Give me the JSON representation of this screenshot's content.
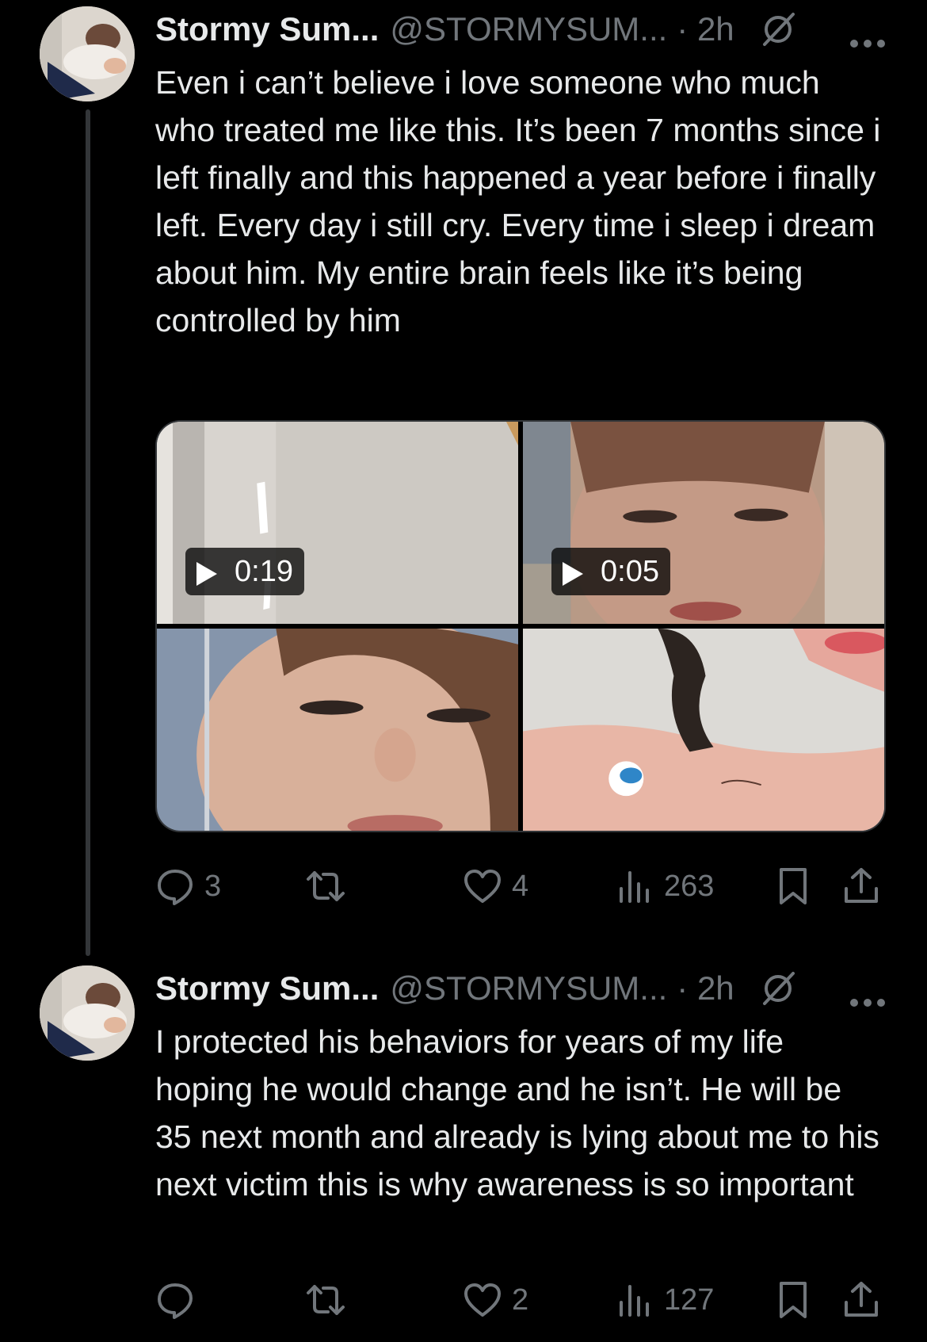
{
  "colors": {
    "background": "#000000",
    "text": "#e7e9ea",
    "secondary": "#71767b",
    "thread_line": "#333639"
  },
  "tweets": [
    {
      "display_name": "Stormy Sum...",
      "handle": "@STORMYSUM...",
      "time": "· 2h",
      "text": "Even i can’t believe i love someone who much who treated me like this. It’s been 7 months since i left finally and this happened a year before i finally left. Every day i still cry. Every time i sleep i dream about him. My entire brain feels like it’s being controlled by him",
      "media": [
        {
          "kind": "video",
          "duration": "0:19"
        },
        {
          "kind": "video",
          "duration": "0:05"
        },
        {
          "kind": "photo"
        },
        {
          "kind": "photo"
        }
      ],
      "actions": {
        "replies": "3",
        "reposts": "",
        "likes": "4",
        "views": "263"
      }
    },
    {
      "display_name": "Stormy Sum...",
      "handle": "@STORMYSUM...",
      "time": "· 2h",
      "text": "I protected his behaviors for years of my life hoping he would change and he isn’t. He will be 35 next month and already is lying about me to his next victim this is why awareness is so important",
      "actions": {
        "replies": "",
        "reposts": "",
        "likes": "2",
        "views": "127"
      }
    }
  ]
}
